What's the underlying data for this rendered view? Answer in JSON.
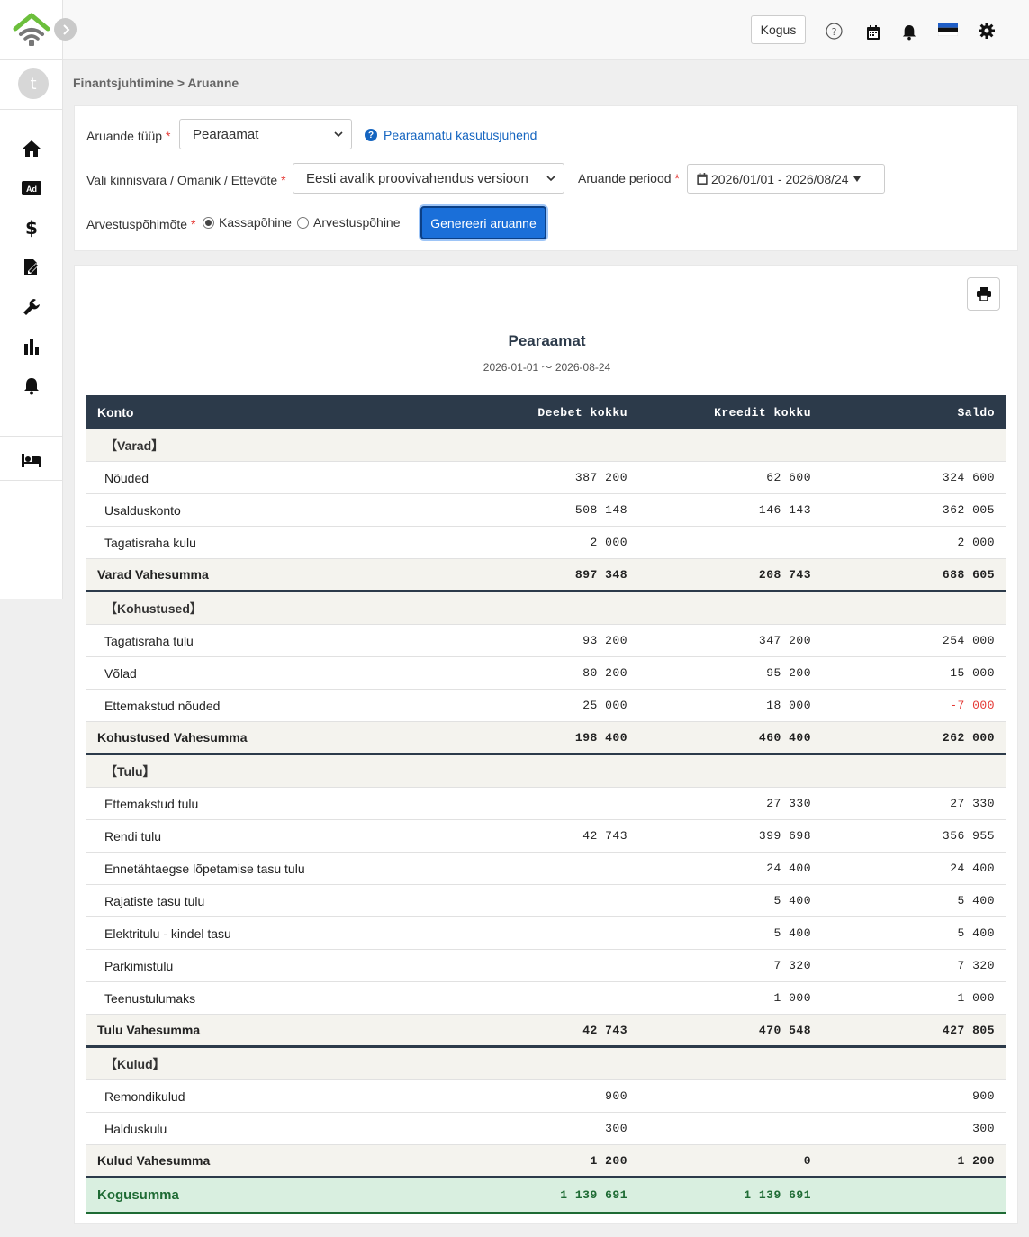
{
  "topbar": {
    "quantity_button": "Kogus"
  },
  "sidebar": {
    "avatar_initial": "t",
    "items": [
      "home-icon",
      "ad-icon",
      "dollar-icon",
      "contract-icon",
      "wrench-icon",
      "chart-icon",
      "bell-icon",
      "bed-icon"
    ]
  },
  "breadcrumb": "Finantsjuhtimine > Aruanne",
  "form": {
    "report_type_label": "Aruande tüüp",
    "report_type_value": "Pearaamat",
    "help_link": "Pearaamatu kasutusjuhend",
    "property_label": "Vali kinnisvara / Omanik / Ettevõte",
    "property_value": "Eesti avalik proovivahendus versioon",
    "period_label": "Aruande periood",
    "period_value": "2026/01/01 - 2026/08/24",
    "basis_label": "Arvestuspõhimõte",
    "basis_cash": "Kassapõhine",
    "basis_accrual": "Arvestuspõhine",
    "basis_selected": "Kassapõhine",
    "generate_button": "Genereeri aruanne"
  },
  "report": {
    "title": "Pearaamat",
    "subtitle": "2026-01-01 〜 2026-08-24",
    "headers": {
      "account": "Konto",
      "debit": "Deebet kokku",
      "credit": "Kreedit kokku",
      "balance": "Saldo"
    },
    "rows": [
      {
        "kind": "cat",
        "name": "【Varad】"
      },
      {
        "kind": "item",
        "name": "Nõuded",
        "debit": "387 200",
        "credit": "62 600",
        "balance": "324 600"
      },
      {
        "kind": "item",
        "name": "Usalduskonto",
        "debit": "508 148",
        "credit": "146 143",
        "balance": "362 005"
      },
      {
        "kind": "item",
        "name": "Tagatisraha kulu",
        "debit": "2 000",
        "credit": "",
        "balance": "2 000"
      },
      {
        "kind": "sub",
        "name": "Varad Vahesumma",
        "debit": "897 348",
        "credit": "208 743",
        "balance": "688 605"
      },
      {
        "kind": "cat",
        "name": "【Kohustused】"
      },
      {
        "kind": "item",
        "name": "Tagatisraha tulu",
        "debit": "93 200",
        "credit": "347 200",
        "balance": "254 000"
      },
      {
        "kind": "item",
        "name": "Võlad",
        "debit": "80 200",
        "credit": "95 200",
        "balance": "15 000"
      },
      {
        "kind": "item",
        "name": "Ettemakstud nõuded",
        "debit": "25 000",
        "credit": "18 000",
        "balance": "-7 000",
        "negative": true
      },
      {
        "kind": "sub",
        "name": "Kohustused Vahesumma",
        "debit": "198 400",
        "credit": "460 400",
        "balance": "262 000"
      },
      {
        "kind": "cat",
        "name": "【Tulu】"
      },
      {
        "kind": "item",
        "name": "Ettemakstud tulu",
        "debit": "",
        "credit": "27 330",
        "balance": "27 330"
      },
      {
        "kind": "item",
        "name": "Rendi tulu",
        "debit": "42 743",
        "credit": "399 698",
        "balance": "356 955"
      },
      {
        "kind": "item",
        "name": "Ennetähtaegse lõpetamise tasu tulu",
        "debit": "",
        "credit": "24 400",
        "balance": "24 400"
      },
      {
        "kind": "item",
        "name": "Rajatiste tasu tulu",
        "debit": "",
        "credit": "5 400",
        "balance": "5 400"
      },
      {
        "kind": "item",
        "name": "Elektritulu - kindel tasu",
        "debit": "",
        "credit": "5 400",
        "balance": "5 400"
      },
      {
        "kind": "item",
        "name": "Parkimistulu",
        "debit": "",
        "credit": "7 320",
        "balance": "7 320"
      },
      {
        "kind": "item",
        "name": "Teenustulumaks",
        "debit": "",
        "credit": "1 000",
        "balance": "1 000"
      },
      {
        "kind": "sub",
        "name": "Tulu Vahesumma",
        "debit": "42 743",
        "credit": "470 548",
        "balance": "427 805"
      },
      {
        "kind": "cat",
        "name": "【Kulud】"
      },
      {
        "kind": "item",
        "name": "Remondikulud",
        "debit": "900",
        "credit": "",
        "balance": "900"
      },
      {
        "kind": "item",
        "name": "Halduskulu",
        "debit": "300",
        "credit": "",
        "balance": "300"
      },
      {
        "kind": "sub",
        "name": "Kulud Vahesumma",
        "debit": "1 200",
        "credit": "0",
        "balance": "1 200"
      },
      {
        "kind": "total",
        "name": "Kogusumma",
        "debit": "1 139 691",
        "credit": "1 139 691",
        "balance": ""
      }
    ]
  }
}
